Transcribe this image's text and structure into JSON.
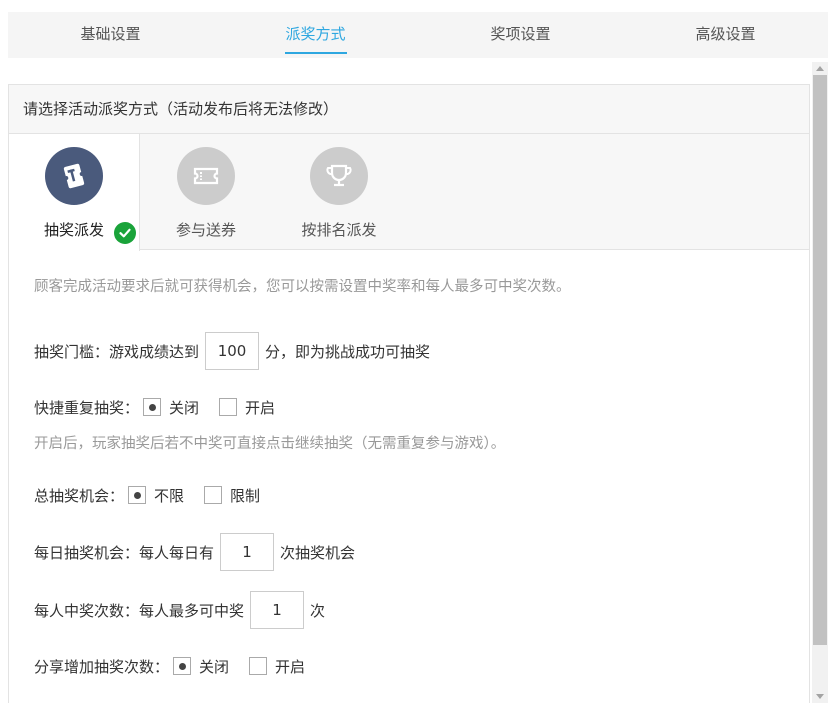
{
  "nav": {
    "tabs": [
      {
        "label": "基础设置"
      },
      {
        "label": "派奖方式"
      },
      {
        "label": "奖项设置"
      },
      {
        "label": "高级设置"
      }
    ],
    "active_index": 1
  },
  "panel": {
    "header": "请选择活动派奖方式（活动发布后将无法修改）",
    "methods": [
      {
        "label": "抽奖派发",
        "icon": "lottery-ticket-icon",
        "active": true
      },
      {
        "label": "参与送券",
        "icon": "coupon-icon",
        "active": false
      },
      {
        "label": "按排名派发",
        "icon": "trophy-icon",
        "active": false
      }
    ]
  },
  "content": {
    "intro": "顾客完成活动要求后就可获得机会，您可以按需设置中奖率和每人最多可中奖次数。",
    "threshold": {
      "label": "抽奖门槛：",
      "prefix": "游戏成绩达到",
      "value": "100",
      "suffix": "分，即为挑战成功可抽奖"
    },
    "quick_repeat": {
      "label": "快捷重复抽奖：",
      "off": "关闭",
      "on": "开启",
      "selected": "off",
      "note": "开启后，玩家抽奖后若不中奖可直接点击继续抽奖（无需重复参与游戏）。"
    },
    "total_chances": {
      "label": "总抽奖机会：",
      "opt1": "不限",
      "opt2": "限制",
      "selected": "opt1"
    },
    "daily_chances": {
      "label": "每日抽奖机会：",
      "prefix": "每人每日有",
      "value": "1",
      "suffix": "次抽奖机会"
    },
    "win_times": {
      "label": "每人中奖次数：",
      "prefix": "每人最多可中奖",
      "value": "1",
      "suffix": "次"
    },
    "share_bonus": {
      "label": "分享增加抽奖次数：",
      "off": "关闭",
      "on": "开启",
      "selected": "off"
    }
  },
  "colors": {
    "accent": "#2ea7e0",
    "check": "#1aa33a",
    "icon_dark": "#4a5a7c",
    "icon_grey": "#cccccc"
  }
}
